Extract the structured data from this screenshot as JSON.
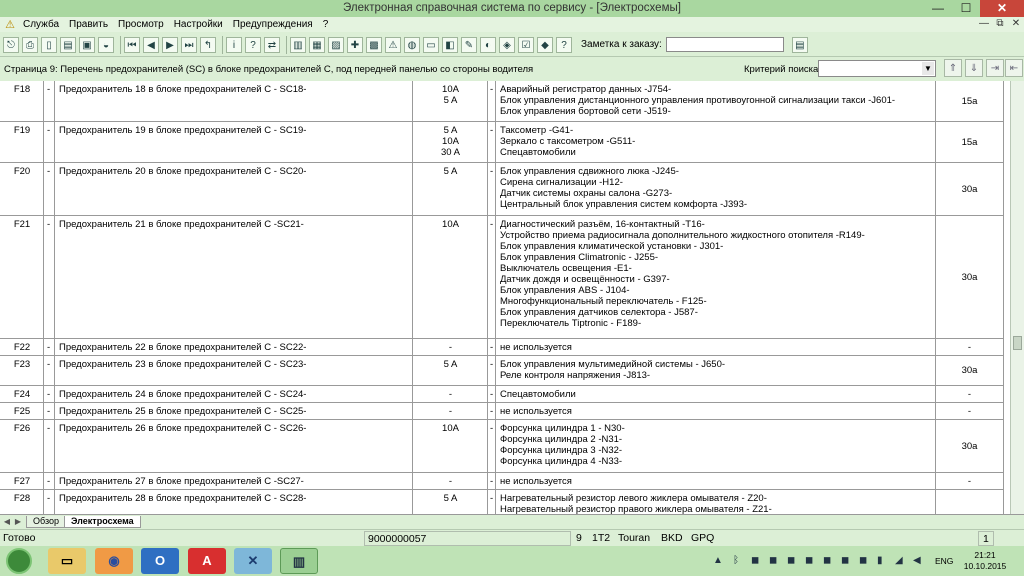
{
  "window": {
    "title": "Электронная справочная система по сервису - [Электросхемы]",
    "minimize": "—",
    "maximize": "☐",
    "close": "✕"
  },
  "menu": {
    "items": [
      "Служба",
      "Править",
      "Просмотр",
      "Настройки",
      "Предупреждения",
      "?"
    ]
  },
  "mdi": {
    "minimize": "—",
    "restore": "⧉",
    "close": "✕"
  },
  "toolbar": {
    "note_label": "Заметка к заказу:",
    "note_value": ""
  },
  "page": {
    "title": "Страница 9: Перечень предохранителей (SC) в блоке предохранителей С, под передней панелью со стороны водителя",
    "criteria_label": "Критерий поиска:",
    "criteria_value": ""
  },
  "table": {
    "rows": [
      {
        "id": "F18",
        "d1": "-",
        "name": "Предохранитель 18 в блоке предохранителей C - SC18-",
        "amps": [
          "10A",
          "5 A"
        ],
        "d2": "-",
        "desc": [
          "Аварийный регистратор данных -J754-",
          "Блок управления дистанционного управления противоугонной сигнализации такси -J601-",
          "Блок управления бортовой сети -J519-"
        ],
        "rate": "15a"
      },
      {
        "id": "F19",
        "d1": "-",
        "name": "Предохранитель 19 в блоке предохранителей C - SC19-",
        "amps": [
          "5 A",
          "10A",
          "30 A"
        ],
        "d2": "-",
        "desc": [
          "Таксометр -G41-",
          "Зеркало с таксометром -G511-",
          "Спецавтомобили"
        ],
        "rate": "15a"
      },
      {
        "id": "F20",
        "d1": "-",
        "name": "Предохранитель 20 в блоке предохранителей C - SC20-",
        "amps": [
          "5 A"
        ],
        "d2": "-",
        "desc": [
          "Блок управления сдвижного люка -J245-",
          "Сирена сигнализации -H12-",
          "Датчик системы охраны салона -G273-",
          "Центральный блок управления систем комфорта -J393-"
        ],
        "rate": "30a"
      },
      {
        "id": "F21",
        "d1": "-",
        "name": "Предохранитель 21 в блоке предохранителей C -SC21-",
        "amps": [
          "10A"
        ],
        "d2": "-",
        "desc": [
          "Диагностический разъём, 16-контактный -T16-",
          "Устройство приема радиосигнала дополнительного жидкостного отопителя -R149-",
          "Блок управления климатической установки - J301-",
          "Блок управления Climatronic - J255-",
          "Выключатель освещения -E1-",
          "Датчик дождя и освещённости - G397-",
          "Блок управления ABS - J104-",
          "Многофункциональный переключатель - F125-",
          "Блок управления датчиков селектора - J587-",
          "Переключатель Tiptronic - F189-"
        ],
        "rate": "30a"
      },
      {
        "id": "F22",
        "d1": "-",
        "name": "Предохранитель 22 в блоке предохранителей C - SC22-",
        "amps": [
          "-"
        ],
        "d2": "-",
        "desc": [
          "не используется"
        ],
        "rate": "-"
      },
      {
        "id": "F23",
        "d1": "-",
        "name": "Предохранитель 23 в блоке предохранителей C - SC23-",
        "amps": [
          "5 A"
        ],
        "d2": "-",
        "desc": [
          "Блок управления мультимедийной системы - J650-",
          "Реле контроля напряжения -J813-"
        ],
        "rate": "30a"
      },
      {
        "id": "F24",
        "d1": "-",
        "name": "Предохранитель 24 в блоке предохранителей C - SC24-",
        "amps": [
          "-"
        ],
        "d2": "-",
        "desc": [
          "Спецавтомобили"
        ],
        "rate": "-"
      },
      {
        "id": "F25",
        "d1": "-",
        "name": "Предохранитель 25 в блоке предохранителей C - SC25-",
        "amps": [
          "-"
        ],
        "d2": "-",
        "desc": [
          "не используется"
        ],
        "rate": "-"
      },
      {
        "id": "F26",
        "d1": "-",
        "name": "Предохранитель 26 в блоке предохранителей C - SC26-",
        "amps": [
          "10A"
        ],
        "d2": "-",
        "desc": [
          "Форсунка цилиндра 1 - N30-",
          "Форсунка цилиндра 2 -N31-",
          "Форсунка цилиндра 3 -N32-",
          "Форсунка цилиндра 4 -N33-"
        ],
        "rate": "30a"
      },
      {
        "id": "F27",
        "d1": "-",
        "name": "Предохранитель 27 в блоке предохранителей C -SC27-",
        "amps": [
          "-"
        ],
        "d2": "-",
        "desc": [
          "не используется"
        ],
        "rate": "-"
      },
      {
        "id": "F28",
        "d1": "-",
        "name": "Предохранитель 28 в блоке предохранителей C - SC28-",
        "amps": [
          "5 A"
        ],
        "d2": "-",
        "desc": [
          "Нагревательный резистор левого жиклера омывателя - Z20-",
          "Нагревательный резистор правого жиклера омывателя - Z21-"
        ],
        "rate": ""
      }
    ]
  },
  "tabs": [
    "Обзор",
    "Электросхема"
  ],
  "status": {
    "ready": "Готово",
    "order": "9000000057",
    "f1": "9",
    "f2": "1T2",
    "f3": "Touran",
    "f4": "BKD",
    "f5": "GPQ",
    "page": "1"
  },
  "taskbar": {
    "lang": "ENG",
    "time": "21:21",
    "date": "10.10.2015"
  }
}
